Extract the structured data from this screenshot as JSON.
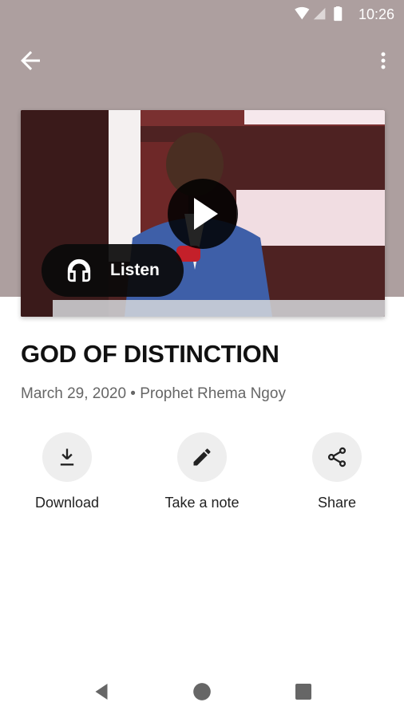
{
  "status_bar": {
    "time": "10:26"
  },
  "header": {
    "background": "#ad9f9f"
  },
  "video": {
    "listen_label": "Listen"
  },
  "sermon": {
    "title": "GOD OF DISTINCTION",
    "meta": "March 29, 2020 • Prophet Rhema Ngoy"
  },
  "actions": [
    {
      "label": "Download",
      "icon": "download-icon"
    },
    {
      "label": "Take a note",
      "icon": "pencil-icon"
    },
    {
      "label": "Share",
      "icon": "share-icon"
    }
  ],
  "nav": {
    "back": "back-triangle",
    "home": "home-circle",
    "recents": "recents-square"
  }
}
